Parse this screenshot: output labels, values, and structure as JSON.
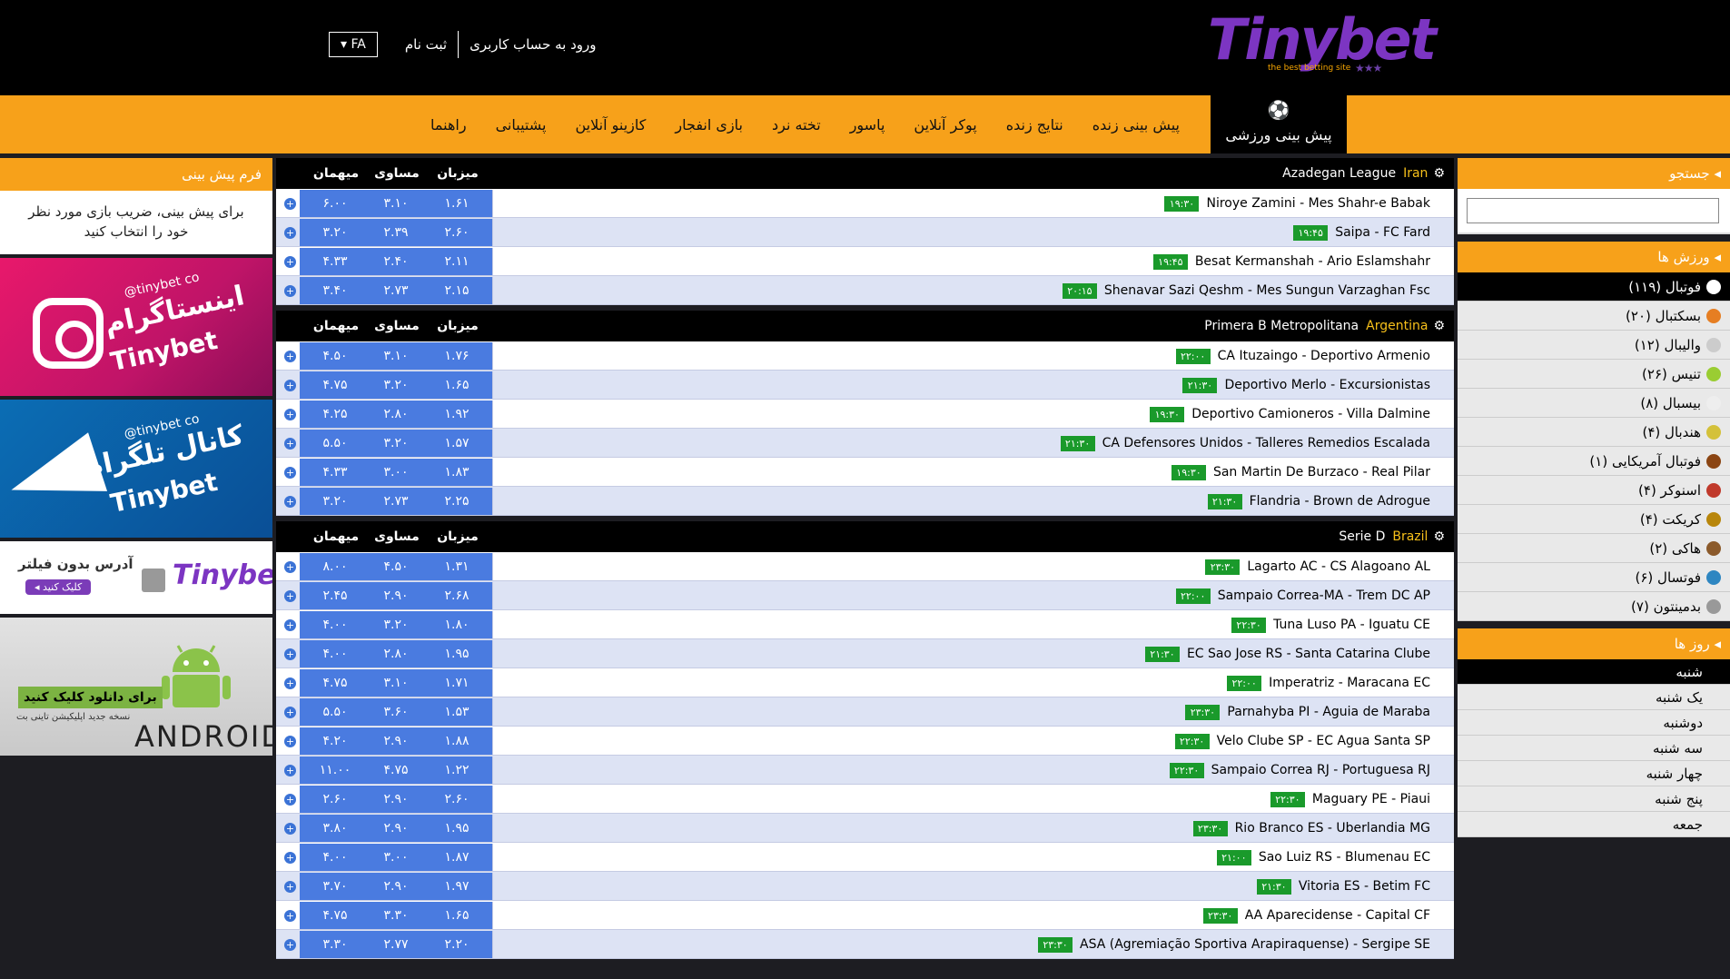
{
  "header": {
    "logo_text": "Tinybet",
    "logo_tagline": "the best betting site",
    "login_label": "ورود به حساب کاربری",
    "register_label": "ثبت نام",
    "lang_label": "FA"
  },
  "nav": {
    "active_label": "پیش بینی ورزشی",
    "items": [
      "پیش بینی زنده",
      "نتایج زنده",
      "پوکر آنلاین",
      "پاسور",
      "تخته نرد",
      "بازی انفجار",
      "کازینو آنلاین",
      "پشتیبانی",
      "راهنما"
    ]
  },
  "right_sidebar": {
    "search_title": "جستجو",
    "sports_title": "ورزش ها",
    "sports": [
      {
        "label": "فوتبال (۱۱۹)",
        "color": "#ffffff"
      },
      {
        "label": "بسکتبال (۲۰)",
        "color": "#e67e22"
      },
      {
        "label": "والیبال (۱۲)",
        "color": "#cccccc"
      },
      {
        "label": "تنیس (۲۶)",
        "color": "#9acd32"
      },
      {
        "label": "بیسبال (۸)",
        "color": "#eeeeee"
      },
      {
        "label": "هندبال (۴)",
        "color": "#d4c13a"
      },
      {
        "label": "فوتبال آمریکایی (۱)",
        "color": "#8b4513"
      },
      {
        "label": "اسنوکر (۴)",
        "color": "#c0392b"
      },
      {
        "label": "کریکت (۴)",
        "color": "#b8860b"
      },
      {
        "label": "هاکی (۲)",
        "color": "#8b5a2b"
      },
      {
        "label": "فوتسال (۶)",
        "color": "#2e86c1"
      },
      {
        "label": "بدمینتون (۷)",
        "color": "#999999"
      }
    ],
    "days_title": "روز ها",
    "days": [
      "شنبه",
      "یک شنبه",
      "دوشنبه",
      "سه شنبه",
      "چهار شنبه",
      "پنج شنبه",
      "جمعه"
    ]
  },
  "left_sidebar": {
    "betform_title": "فرم پیش بینی",
    "betform_text": "برای پیش بینی، ضریب بازی مورد نظر خود را انتخاب کنید",
    "insta_title": "اینستاگرام",
    "insta_brand": "Tinybet",
    "insta_handle": "@tinybet co",
    "tele_title": "کانال تلگرام",
    "tele_brand": "Tinybet",
    "tele_handle": "@tinybet co",
    "filter_text": "آدرس بدون فیلتر",
    "filter_button": "کلیک کنید",
    "filter_brand": "Tinybet",
    "android_button": "برای دانلود کلیک کنید",
    "android_sub": "نسخه جدید اپلیکیشن تاینی بت",
    "android_word": "ANDROID"
  },
  "columns": {
    "home": "میزبان",
    "draw": "مساوی",
    "away": "میهمان"
  },
  "leagues": [
    {
      "country": "Iran",
      "name": "Azadegan League",
      "matches": [
        {
          "home": "Mes Shahr-e Babak",
          "away": "Niroye Zamini",
          "time": "۱۹:۳۰",
          "h": "۱.۶۱",
          "d": "۳.۱۰",
          "a": "۶.۰۰"
        },
        {
          "home": "FC Fard",
          "away": "Saipa",
          "time": "۱۹:۴۵",
          "h": "۲.۶۰",
          "d": "۲.۳۹",
          "a": "۳.۲۰"
        },
        {
          "home": "Ario Eslamshahr",
          "away": "Besat Kermanshah",
          "time": "۱۹:۴۵",
          "h": "۲.۱۱",
          "d": "۲.۴۰",
          "a": "۴.۳۳"
        },
        {
          "home": "Mes Sungun Varzaghan Fsc",
          "away": "Shenavar Sazi Qeshm",
          "time": "۲۰:۱۵",
          "h": "۲.۱۵",
          "d": "۲.۷۳",
          "a": "۳.۴۰"
        }
      ]
    },
    {
      "country": "Argentina",
      "name": "Primera B Metropolitana",
      "matches": [
        {
          "home": "Deportivo Armenio",
          "away": "CA Ituzaingo",
          "time": "۲۲:۰۰",
          "h": "۱.۷۶",
          "d": "۳.۱۰",
          "a": "۴.۵۰"
        },
        {
          "home": "Excursionistas",
          "away": "Deportivo Merlo",
          "time": "۲۱:۳۰",
          "h": "۱.۶۵",
          "d": "۳.۲۰",
          "a": "۴.۷۵"
        },
        {
          "home": "Villa Dalmine",
          "away": "Deportivo Camioneros",
          "time": "۱۹:۳۰",
          "h": "۱.۹۲",
          "d": "۲.۸۰",
          "a": "۴.۲۵"
        },
        {
          "home": "Talleres Remedios Escalada",
          "away": "CA Defensores Unidos",
          "time": "۲۱:۳۰",
          "h": "۱.۵۷",
          "d": "۳.۲۰",
          "a": "۵.۵۰"
        },
        {
          "home": "Real Pilar",
          "away": "San Martin De Burzaco",
          "time": "۱۹:۳۰",
          "h": "۱.۸۳",
          "d": "۳.۰۰",
          "a": "۴.۳۳"
        },
        {
          "home": "Brown de Adrogue",
          "away": "Flandria",
          "time": "۲۱:۳۰",
          "h": "۲.۲۵",
          "d": "۲.۷۳",
          "a": "۳.۲۰"
        }
      ]
    },
    {
      "country": "Brazil",
      "name": "Serie D",
      "matches": [
        {
          "home": "CS Alagoano AL",
          "away": "Lagarto AC",
          "time": "۲۳:۳۰",
          "h": "۱.۳۱",
          "d": "۴.۵۰",
          "a": "۸.۰۰"
        },
        {
          "home": "Trem DC AP",
          "away": "Sampaio Correa-MA",
          "time": "۲۲:۰۰",
          "h": "۲.۶۸",
          "d": "۲.۹۰",
          "a": "۲.۴۵"
        },
        {
          "home": "Iguatu CE",
          "away": "Tuna Luso PA",
          "time": "۲۲:۳۰",
          "h": "۱.۸۰",
          "d": "۳.۲۰",
          "a": "۴.۰۰"
        },
        {
          "home": "Santa Catarina Clube",
          "away": "EC Sao Jose RS",
          "time": "۲۱:۳۰",
          "h": "۱.۹۵",
          "d": "۲.۸۰",
          "a": "۴.۰۰"
        },
        {
          "home": "Maracana EC",
          "away": "Imperatriz",
          "time": "۲۲:۰۰",
          "h": "۱.۷۱",
          "d": "۳.۱۰",
          "a": "۴.۷۵"
        },
        {
          "home": "Aguia de Maraba",
          "away": "Parnahyba PI",
          "time": "۲۳:۳۰",
          "h": "۱.۵۳",
          "d": "۳.۶۰",
          "a": "۵.۵۰"
        },
        {
          "home": "EC Agua Santa SP",
          "away": "Velo Clube SP",
          "time": "۲۲:۳۰",
          "h": "۱.۸۸",
          "d": "۲.۹۰",
          "a": "۴.۲۰"
        },
        {
          "home": "Portuguesa RJ",
          "away": "Sampaio Correa RJ",
          "time": "۲۲:۳۰",
          "h": "۱.۲۲",
          "d": "۴.۷۵",
          "a": "۱۱.۰۰"
        },
        {
          "home": "Piaui",
          "away": "Maguary PE",
          "time": "۲۲:۳۰",
          "h": "۲.۶۰",
          "d": "۲.۹۰",
          "a": "۲.۶۰"
        },
        {
          "home": "Uberlandia MG",
          "away": "Rio Branco ES",
          "time": "۲۳:۳۰",
          "h": "۱.۹۵",
          "d": "۲.۹۰",
          "a": "۳.۸۰"
        },
        {
          "home": "Blumenau EC",
          "away": "Sao Luiz RS",
          "time": "۲۱:۰۰",
          "h": "۱.۸۷",
          "d": "۳.۰۰",
          "a": "۴.۰۰"
        },
        {
          "home": "Betim FC",
          "away": "Vitoria ES",
          "time": "۲۱:۳۰",
          "h": "۱.۹۷",
          "d": "۲.۹۰",
          "a": "۳.۷۰"
        },
        {
          "home": "Capital CF",
          "away": "AA Aparecidense",
          "time": "۲۳:۳۰",
          "h": "۱.۶۵",
          "d": "۳.۳۰",
          "a": "۴.۷۵"
        },
        {
          "home": "Sergipe SE",
          "away": "ASA (Agremiação Sportiva Arapiraquense)",
          "time": "۲۳:۳۰",
          "h": "۲.۲۰",
          "d": "۲.۷۷",
          "a": "۳.۳۰"
        }
      ]
    }
  ]
}
